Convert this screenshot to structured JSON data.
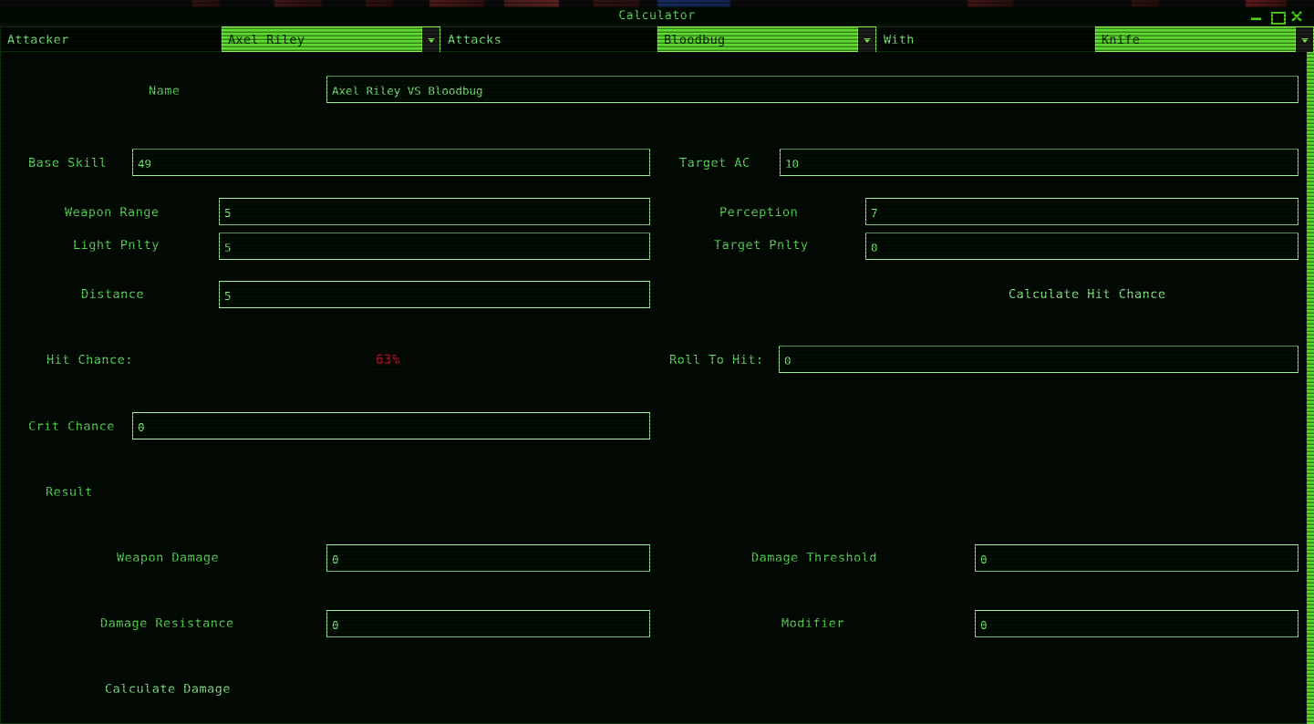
{
  "window": {
    "title": "Calculator",
    "controls": {
      "minimize": "minimize",
      "maximize": "maximize",
      "close": "close"
    }
  },
  "selector_bar": {
    "attacker_label": "Attacker",
    "attacker_value": "Axel Riley",
    "attacks_label": "Attacks",
    "target_value": "Bloodbug",
    "with_label": "With",
    "weapon_value": "Knife"
  },
  "form": {
    "name_label": "Name",
    "name_value": "Axel Riley VS Bloodbug",
    "base_skill_label": "Base Skill",
    "base_skill_value": "49",
    "target_ac_label": "Target AC",
    "target_ac_value": "10",
    "weapon_range_label": "Weapon Range",
    "weapon_range_value": "5",
    "perception_label": "Perception",
    "perception_value": "7",
    "light_pnlty_label": "Light Pnlty",
    "light_pnlty_value": "5",
    "target_pnlty_label": "Target Pnlty",
    "target_pnlty_value": "0",
    "distance_label": "Distance",
    "distance_value": "5",
    "calculate_hit_chance_label": "Calculate Hit Chance",
    "hit_chance_label": "Hit Chance:",
    "hit_chance_value": "63%",
    "roll_to_hit_label": "Roll To Hit:",
    "roll_to_hit_value": "0",
    "crit_chance_label": "Crit Chance",
    "crit_chance_value": "0",
    "result_label": "Result",
    "weapon_damage_label": "Weapon Damage",
    "weapon_damage_value": "0",
    "damage_threshold_label": "Damage Threshold",
    "damage_threshold_value": "0",
    "damage_resistance_label": "Damage Resistance",
    "damage_resistance_value": "0",
    "modifier_label": "Modifier",
    "modifier_value": "0",
    "calculate_damage_label": "Calculate Damage"
  },
  "colors": {
    "terminal_green": "#5fe05f",
    "accent_green": "#5ddb2e",
    "alert_red": "#b3162a",
    "background": "#030a03"
  }
}
